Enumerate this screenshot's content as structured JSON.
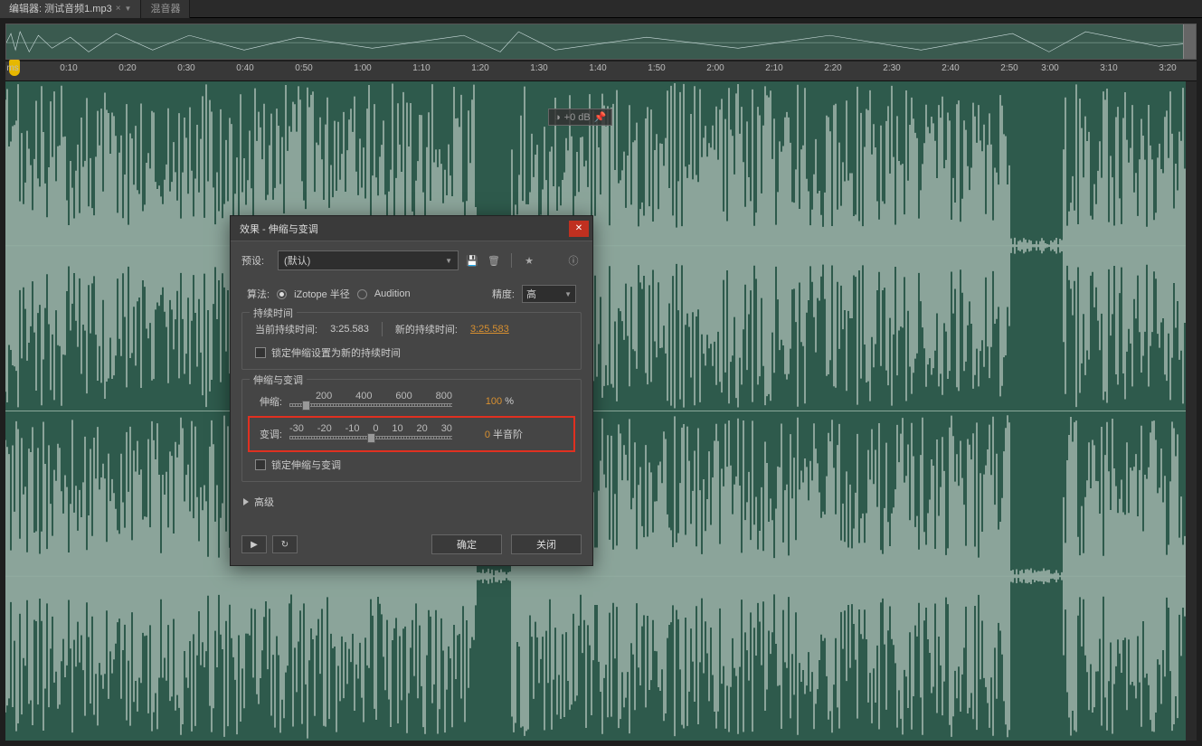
{
  "tabs": {
    "editor": "编辑器: 测试音频1.mp3",
    "mixer": "混音器"
  },
  "timeline": {
    "start_label": "ms",
    "ticks": [
      "0:10",
      "0:20",
      "0:30",
      "0:40",
      "0:50",
      "1:00",
      "1:10",
      "1:20",
      "1:30",
      "1:40",
      "1:50",
      "2:00",
      "2:10",
      "2:20",
      "2:30",
      "2:40",
      "2:50",
      "3:00",
      "3:10",
      "3:20"
    ]
  },
  "floating_toolbar": {
    "db": "+0 dB"
  },
  "dialog": {
    "title": "效果 - 伸缩与变调",
    "preset_label": "预设:",
    "preset_value": "(默认)",
    "algorithm_label": "算法:",
    "algorithm_opt1": "iZotope 半径",
    "algorithm_opt2": "Audition",
    "precision_label": "精度:",
    "precision_value": "高",
    "section_duration": "持续时间",
    "current_duration_label": "当前持续时间:",
    "current_duration_value": "3:25.583",
    "new_duration_label": "新的持续时间:",
    "new_duration_value": "3:25.583",
    "lock_new_duration": "锁定伸缩设置为新的持续时间",
    "section_stretch": "伸缩与变调",
    "stretch_label": "伸缩:",
    "stretch_ticks": [
      "200",
      "400",
      "600",
      "800"
    ],
    "stretch_value": "100",
    "stretch_unit": "%",
    "pitch_label": "变调:",
    "pitch_ticks": [
      "-30",
      "-20",
      "-10",
      "0",
      "10",
      "20",
      "30"
    ],
    "pitch_value": "0",
    "pitch_unit": "半音阶",
    "lock_stretch_pitch": "锁定伸缩与变调",
    "advanced": "高级",
    "ok": "确定",
    "close": "关闭"
  }
}
